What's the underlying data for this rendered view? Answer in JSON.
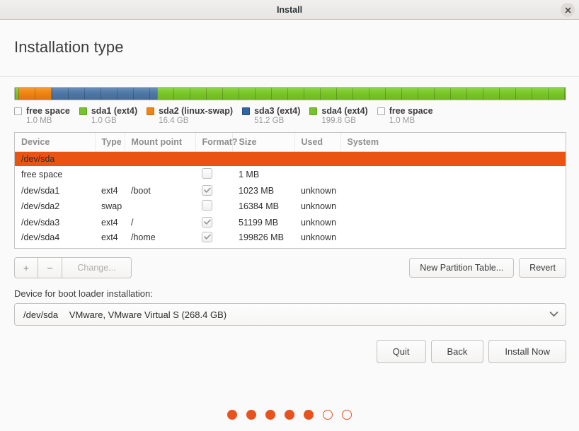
{
  "window": {
    "title": "Install",
    "close_icon": "close-icon"
  },
  "page": {
    "title": "Installation type"
  },
  "colors": {
    "accent_orange": "#ea5412",
    "dot_orange": "#e8521f",
    "partition_green": "#78c32b",
    "partition_orange": "#ef8413",
    "partition_blue": "#3465a4",
    "free_space": "#fbfbfb"
  },
  "partition_bar": {
    "segments": [
      {
        "name": "sda1 (ext4)",
        "color_key": "green",
        "percent": 0.6
      },
      {
        "name": "sda2 (linux-swap)",
        "color_key": "orange",
        "percent": 6.1
      },
      {
        "name": "sda3 (ext4)",
        "color_key": "blue",
        "percent": 19.1
      },
      {
        "name": "sda4 (ext4)",
        "color_key": "green",
        "percent": 74.2
      }
    ]
  },
  "legend": [
    {
      "name": "free space",
      "size": "1.0 MB",
      "swatch": "free"
    },
    {
      "name": "sda1 (ext4)",
      "size": "1.0 GB",
      "swatch": "green"
    },
    {
      "name": "sda2 (linux-swap)",
      "size": "16.4 GB",
      "swatch": "orange"
    },
    {
      "name": "sda3 (ext4)",
      "size": "51.2 GB",
      "swatch": "blue"
    },
    {
      "name": "sda4 (ext4)",
      "size": "199.8 GB",
      "swatch": "green"
    },
    {
      "name": "free space",
      "size": "1.0 MB",
      "swatch": "free"
    }
  ],
  "table": {
    "columns": [
      "Device",
      "Type",
      "Mount point",
      "Format?",
      "Size",
      "Used",
      "System"
    ],
    "disk_row": {
      "device": "/dev/sda"
    },
    "rows": [
      {
        "device": "free space",
        "type": "",
        "mount": "",
        "format": false,
        "format_visible": true,
        "size": "1 MB",
        "used": "",
        "system": ""
      },
      {
        "device": "/dev/sda1",
        "type": "ext4",
        "mount": "/boot",
        "format": true,
        "format_visible": true,
        "size": "1023 MB",
        "used": "unknown",
        "system": ""
      },
      {
        "device": "/dev/sda2",
        "type": "swap",
        "mount": "",
        "format": false,
        "format_visible": true,
        "size": "16384 MB",
        "used": "unknown",
        "system": ""
      },
      {
        "device": "/dev/sda3",
        "type": "ext4",
        "mount": "/",
        "format": true,
        "format_visible": true,
        "size": "51199 MB",
        "used": "unknown",
        "system": ""
      },
      {
        "device": "/dev/sda4",
        "type": "ext4",
        "mount": "/home",
        "format": true,
        "format_visible": true,
        "size": "199826 MB",
        "used": "unknown",
        "system": ""
      }
    ]
  },
  "toolbar": {
    "add_label": "+",
    "remove_label": "−",
    "change_label": "Change...",
    "new_partition_table_label": "New Partition Table...",
    "revert_label": "Revert"
  },
  "bootloader": {
    "label": "Device for boot loader installation:",
    "selected_device": "/dev/sda",
    "selected_description": "VMware, VMware Virtual S (268.4 GB)",
    "chevron_icon": "chevron-down-icon"
  },
  "actions": {
    "quit_label": "Quit",
    "back_label": "Back",
    "install_label": "Install Now"
  },
  "progress_dots": {
    "total": 7,
    "filled": 5
  }
}
